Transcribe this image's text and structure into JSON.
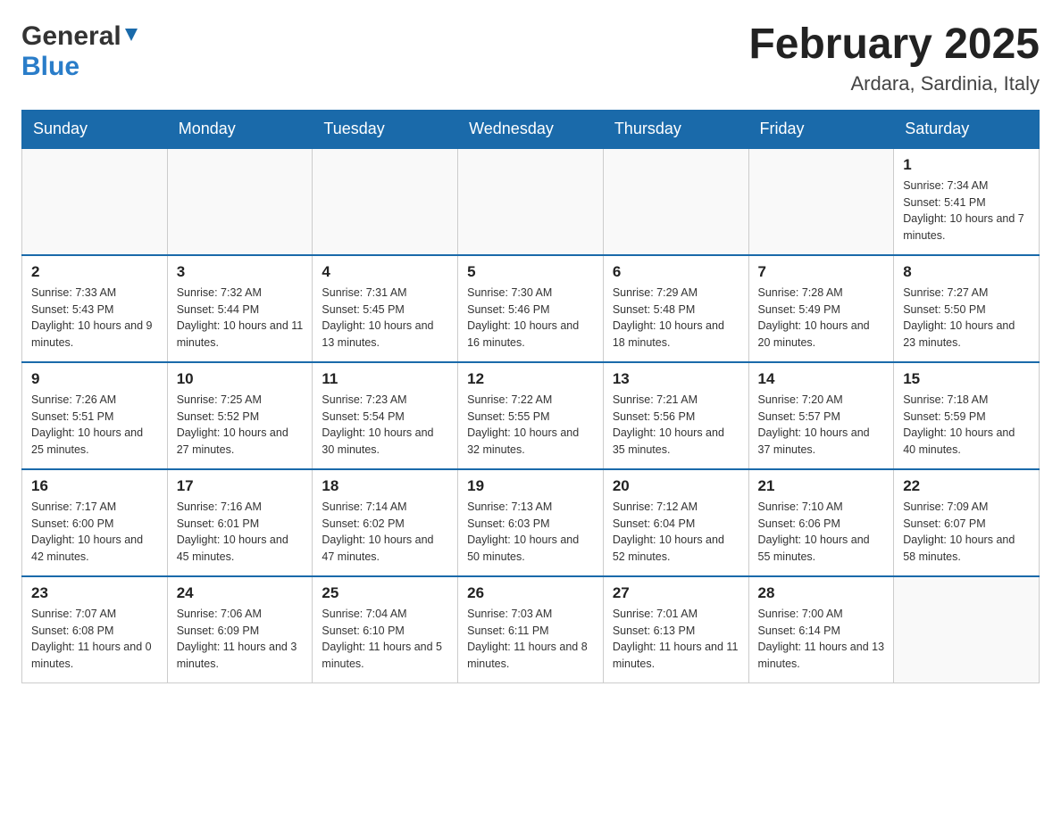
{
  "header": {
    "logo": {
      "general": "General",
      "blue": "Blue"
    },
    "title": "February 2025",
    "location": "Ardara, Sardinia, Italy"
  },
  "days_of_week": [
    "Sunday",
    "Monday",
    "Tuesday",
    "Wednesday",
    "Thursday",
    "Friday",
    "Saturday"
  ],
  "weeks": [
    [
      {
        "day": "",
        "info": ""
      },
      {
        "day": "",
        "info": ""
      },
      {
        "day": "",
        "info": ""
      },
      {
        "day": "",
        "info": ""
      },
      {
        "day": "",
        "info": ""
      },
      {
        "day": "",
        "info": ""
      },
      {
        "day": "1",
        "info": "Sunrise: 7:34 AM\nSunset: 5:41 PM\nDaylight: 10 hours and 7 minutes."
      }
    ],
    [
      {
        "day": "2",
        "info": "Sunrise: 7:33 AM\nSunset: 5:43 PM\nDaylight: 10 hours and 9 minutes."
      },
      {
        "day": "3",
        "info": "Sunrise: 7:32 AM\nSunset: 5:44 PM\nDaylight: 10 hours and 11 minutes."
      },
      {
        "day": "4",
        "info": "Sunrise: 7:31 AM\nSunset: 5:45 PM\nDaylight: 10 hours and 13 minutes."
      },
      {
        "day": "5",
        "info": "Sunrise: 7:30 AM\nSunset: 5:46 PM\nDaylight: 10 hours and 16 minutes."
      },
      {
        "day": "6",
        "info": "Sunrise: 7:29 AM\nSunset: 5:48 PM\nDaylight: 10 hours and 18 minutes."
      },
      {
        "day": "7",
        "info": "Sunrise: 7:28 AM\nSunset: 5:49 PM\nDaylight: 10 hours and 20 minutes."
      },
      {
        "day": "8",
        "info": "Sunrise: 7:27 AM\nSunset: 5:50 PM\nDaylight: 10 hours and 23 minutes."
      }
    ],
    [
      {
        "day": "9",
        "info": "Sunrise: 7:26 AM\nSunset: 5:51 PM\nDaylight: 10 hours and 25 minutes."
      },
      {
        "day": "10",
        "info": "Sunrise: 7:25 AM\nSunset: 5:52 PM\nDaylight: 10 hours and 27 minutes."
      },
      {
        "day": "11",
        "info": "Sunrise: 7:23 AM\nSunset: 5:54 PM\nDaylight: 10 hours and 30 minutes."
      },
      {
        "day": "12",
        "info": "Sunrise: 7:22 AM\nSunset: 5:55 PM\nDaylight: 10 hours and 32 minutes."
      },
      {
        "day": "13",
        "info": "Sunrise: 7:21 AM\nSunset: 5:56 PM\nDaylight: 10 hours and 35 minutes."
      },
      {
        "day": "14",
        "info": "Sunrise: 7:20 AM\nSunset: 5:57 PM\nDaylight: 10 hours and 37 minutes."
      },
      {
        "day": "15",
        "info": "Sunrise: 7:18 AM\nSunset: 5:59 PM\nDaylight: 10 hours and 40 minutes."
      }
    ],
    [
      {
        "day": "16",
        "info": "Sunrise: 7:17 AM\nSunset: 6:00 PM\nDaylight: 10 hours and 42 minutes."
      },
      {
        "day": "17",
        "info": "Sunrise: 7:16 AM\nSunset: 6:01 PM\nDaylight: 10 hours and 45 minutes."
      },
      {
        "day": "18",
        "info": "Sunrise: 7:14 AM\nSunset: 6:02 PM\nDaylight: 10 hours and 47 minutes."
      },
      {
        "day": "19",
        "info": "Sunrise: 7:13 AM\nSunset: 6:03 PM\nDaylight: 10 hours and 50 minutes."
      },
      {
        "day": "20",
        "info": "Sunrise: 7:12 AM\nSunset: 6:04 PM\nDaylight: 10 hours and 52 minutes."
      },
      {
        "day": "21",
        "info": "Sunrise: 7:10 AM\nSunset: 6:06 PM\nDaylight: 10 hours and 55 minutes."
      },
      {
        "day": "22",
        "info": "Sunrise: 7:09 AM\nSunset: 6:07 PM\nDaylight: 10 hours and 58 minutes."
      }
    ],
    [
      {
        "day": "23",
        "info": "Sunrise: 7:07 AM\nSunset: 6:08 PM\nDaylight: 11 hours and 0 minutes."
      },
      {
        "day": "24",
        "info": "Sunrise: 7:06 AM\nSunset: 6:09 PM\nDaylight: 11 hours and 3 minutes."
      },
      {
        "day": "25",
        "info": "Sunrise: 7:04 AM\nSunset: 6:10 PM\nDaylight: 11 hours and 5 minutes."
      },
      {
        "day": "26",
        "info": "Sunrise: 7:03 AM\nSunset: 6:11 PM\nDaylight: 11 hours and 8 minutes."
      },
      {
        "day": "27",
        "info": "Sunrise: 7:01 AM\nSunset: 6:13 PM\nDaylight: 11 hours and 11 minutes."
      },
      {
        "day": "28",
        "info": "Sunrise: 7:00 AM\nSunset: 6:14 PM\nDaylight: 11 hours and 13 minutes."
      },
      {
        "day": "",
        "info": ""
      }
    ]
  ]
}
